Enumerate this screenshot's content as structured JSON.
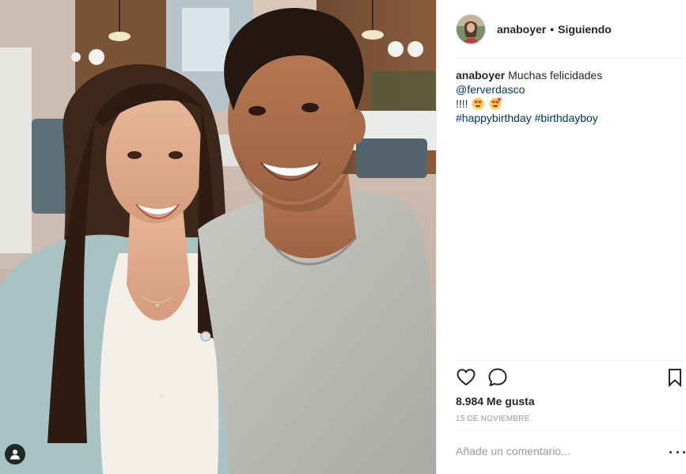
{
  "post": {
    "username": "anaboyer",
    "separator": "•",
    "follow_status": "Siguiendo",
    "caption": {
      "username": "anaboyer",
      "text_before": "Muchas felicidades",
      "mention": "@ferverdasco",
      "text_after": "!!!!",
      "hashtags": [
        "#happybirthday",
        "#birthdayboy"
      ],
      "emojis": [
        "heart-eyes-emoji",
        "heart-eyes-emoji"
      ]
    },
    "likes": "8.984 Me gusta",
    "date": "15 DE NOVIEMBRE",
    "comment_placeholder": "Añade un comentario...",
    "icons": {
      "like": "heart-icon",
      "comment": "comment-bubble-icon",
      "save": "bookmark-icon",
      "more": "more-options-icon",
      "tag": "user-tag-icon"
    },
    "colors": {
      "link": "#003569",
      "text": "#262626",
      "muted": "#999999",
      "divider": "#efefef"
    }
  }
}
